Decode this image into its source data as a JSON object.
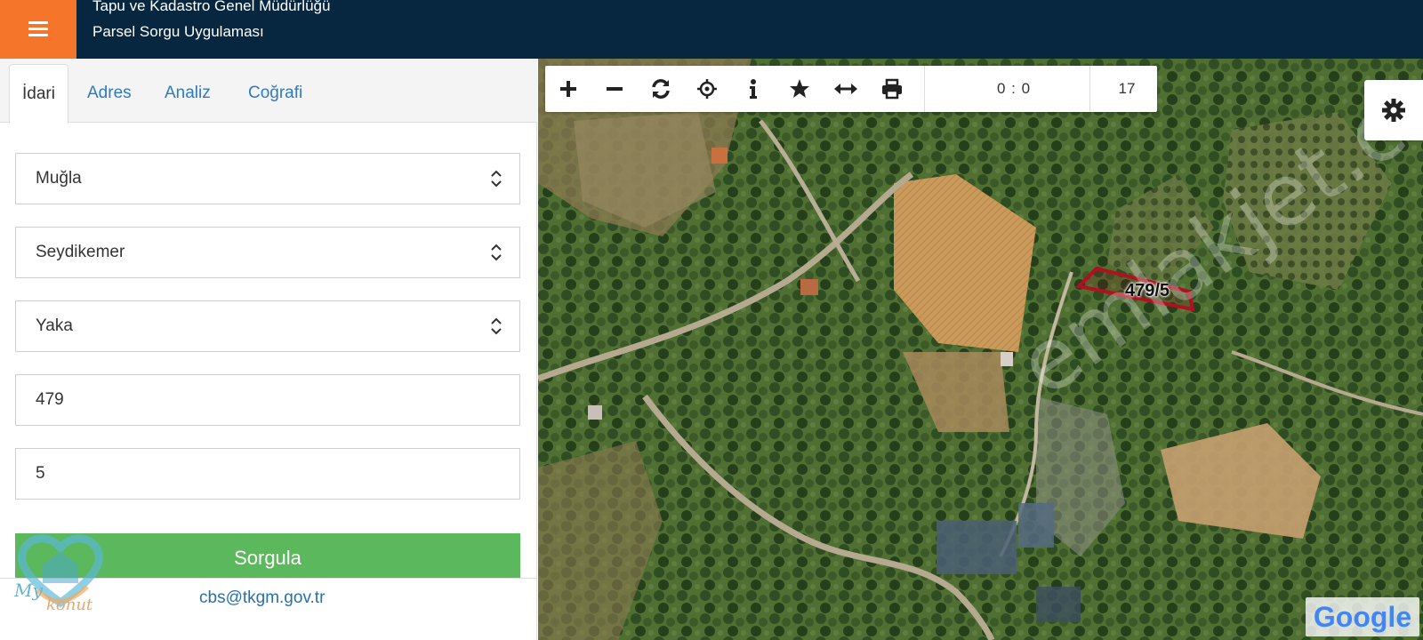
{
  "header": {
    "title_line1": "Tapu ve Kadastro Genel Müdürlüğü",
    "title_line2": "Parsel Sorgu Uygulaması"
  },
  "tabs": [
    {
      "label": "İdari"
    },
    {
      "label": "Adres"
    },
    {
      "label": "Analiz"
    },
    {
      "label": "Coğrafi"
    }
  ],
  "form": {
    "il": "Muğla",
    "ilce": "Seydikemer",
    "mahalle": "Yaka",
    "ada": "479",
    "parsel": "5",
    "submit_label": "Sorgula"
  },
  "footer": {
    "contact_email": "cbs@tkgm.gov.tr",
    "logo_text_1": "My",
    "logo_text_2": "konut"
  },
  "map": {
    "coordinate_readout": "0 : 0",
    "zoom_level": "17",
    "parcel_label": "479/5",
    "watermark": "emlakjet.com",
    "attribution": "Google"
  },
  "colors": {
    "header_bg": "#07263f",
    "menu_accent": "#f5762a",
    "submit_green": "#5cb85c",
    "link_blue": "#2e7bbf",
    "parcel_outline": "#b01020"
  },
  "icons": {
    "toolbar": [
      "zoom-in-icon",
      "zoom-out-icon",
      "refresh-icon",
      "locate-icon",
      "info-icon",
      "favorite-icon",
      "measure-icon",
      "print-icon"
    ],
    "settings": "gear-icon",
    "menu": "hamburger-icon"
  }
}
